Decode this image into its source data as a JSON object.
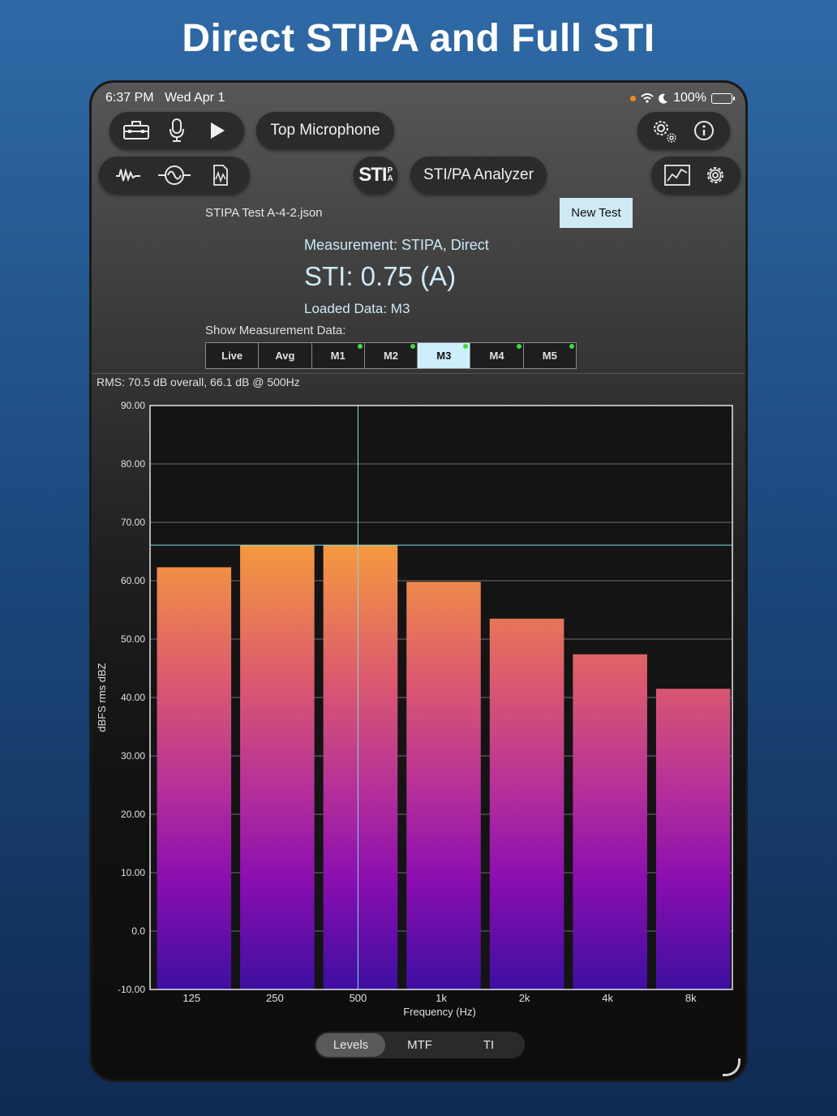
{
  "promo_title": "Direct STIPA and Full STI",
  "status": {
    "time": "6:37 PM",
    "date": "Wed Apr 1",
    "battery": "100%"
  },
  "toolbar": {
    "mic_label": "Top Microphone",
    "analyzer_label": "STI/PA Analyzer",
    "sti_icon_label": "STI"
  },
  "file": {
    "name": "STIPA Test A-4-2.json",
    "new_test_label": "New Test"
  },
  "measurement": {
    "type": "Measurement: STIPA, Direct",
    "sti": "STI: 0.75 (A)",
    "loaded": "Loaded Data: M3",
    "show_label": "Show Measurement Data:"
  },
  "segments": [
    {
      "label": "Live",
      "dot": false,
      "active": false
    },
    {
      "label": "Avg",
      "dot": false,
      "active": false
    },
    {
      "label": "M1",
      "dot": true,
      "active": false
    },
    {
      "label": "M2",
      "dot": true,
      "active": false
    },
    {
      "label": "M3",
      "dot": true,
      "active": true
    },
    {
      "label": "M4",
      "dot": true,
      "active": false
    },
    {
      "label": "M5",
      "dot": true,
      "active": false
    }
  ],
  "rms_text": "RMS: 70.5 dB overall, 66.1 dB @ 500Hz",
  "bottom_tabs": [
    {
      "label": "Levels",
      "active": true
    },
    {
      "label": "MTF",
      "active": false
    },
    {
      "label": "TI",
      "active": false
    }
  ],
  "colors": {
    "accent": "#cdeffc",
    "cursor_line": "#7fe0e0",
    "bar_top": "#f59a3e",
    "bar_bottom": "#3c0fa0"
  },
  "chart_data": {
    "type": "bar",
    "categories": [
      "125",
      "250",
      "500",
      "1k",
      "2k",
      "4k",
      "8k"
    ],
    "values": [
      62.3,
      66.1,
      66.1,
      59.8,
      53.5,
      47.4,
      41.5
    ],
    "ylim": [
      -10,
      90
    ],
    "yticks": [
      "90.00",
      "80.00",
      "70.00",
      "60.00",
      "50.00",
      "40.00",
      "30.00",
      "20.00",
      "10.00",
      "0.0",
      "-10.00"
    ],
    "xlabel": "Frequency (Hz)",
    "ylabel": "dBFS rms dBZ",
    "cursor_category": "500",
    "cursor_value": 66.1,
    "grid": true
  }
}
